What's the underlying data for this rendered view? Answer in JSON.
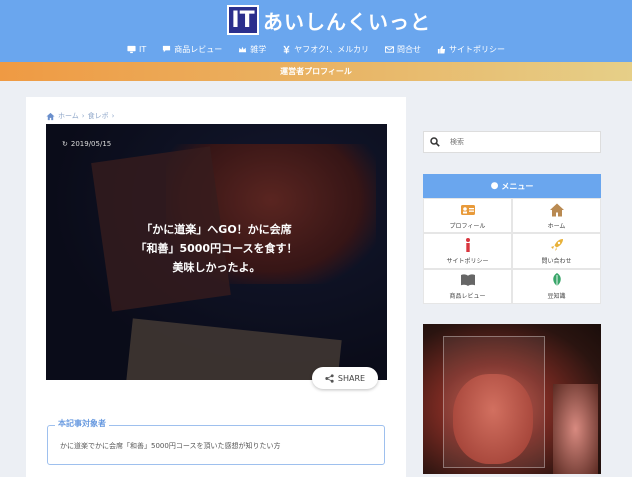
{
  "site": {
    "logo_mark": "IT",
    "name": "あいしんくいっと"
  },
  "nav": {
    "items": [
      {
        "label": "IT",
        "icon": "monitor-icon"
      },
      {
        "label": "商品レビュー",
        "icon": "chat-icon"
      },
      {
        "label": "雑学",
        "icon": "crown-icon"
      },
      {
        "label": "ヤフオク!、メルカリ",
        "icon": "yen-icon"
      },
      {
        "label": "問合せ",
        "icon": "mail-icon"
      },
      {
        "label": "サイトポリシー",
        "icon": "thumb-icon"
      }
    ]
  },
  "subbar": {
    "label": "運営者プロフィール"
  },
  "breadcrumb": {
    "home": "ホーム",
    "sep": "›",
    "category": "食レポ",
    "sep2": "›"
  },
  "article": {
    "date": "2019/05/15",
    "title_line1": "「かに道楽」へGO！かに会席",
    "title_line2": "「和善」5000円コースを食す！",
    "title_line3": "美味しかったよ。",
    "share_label": "SHARE"
  },
  "target": {
    "label": "本記事対象者",
    "text": "かに道楽でかに会席「和善」5000円コースを頂いた感想が知りたい方"
  },
  "sidebar": {
    "search_placeholder": "検索",
    "menu_title": "メニュー",
    "menu_items": [
      {
        "label": "プロフィール",
        "icon": "profile-card-icon"
      },
      {
        "label": "ホーム",
        "icon": "home-icon"
      },
      {
        "label": "サイトポリシー",
        "icon": "info-icon"
      },
      {
        "label": "問い合わせ",
        "icon": "rocket-icon"
      },
      {
        "label": "商品レビュー",
        "icon": "book-icon"
      },
      {
        "label": "豆知識",
        "icon": "leaf-icon"
      }
    ]
  },
  "colors": {
    "header": "#6aa6ee",
    "accent_orange": "#ef9a43",
    "menu_green": "#3aa66a"
  }
}
